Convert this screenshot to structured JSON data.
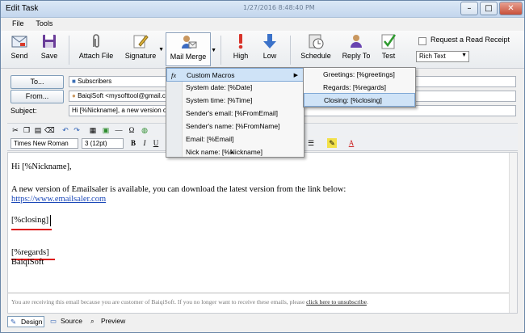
{
  "window": {
    "title": "Edit Task",
    "center_text": "1/27/2016 8:48:40 PM"
  },
  "menubar": [
    "File",
    "Tools"
  ],
  "toolbar": {
    "send": "Send",
    "save": "Save",
    "attach": "Attach File",
    "signature": "Signature",
    "mail_merge": "Mail Merge",
    "high": "High",
    "low": "Low",
    "schedule": "Schedule",
    "reply_to": "Reply To",
    "test": "Test",
    "read_receipt": "Request a Read Receipt",
    "format": "Rich Text"
  },
  "header": {
    "to_button": "To...",
    "to_value": "Subscribers",
    "from_button": "From...",
    "from_value": "BaiqiSoft <mysofttool@gmail.com>",
    "subject_label": "Subject:",
    "subject_value": "Hi [%Nickname], a new version of E"
  },
  "format_bar": {
    "font": "Times New Roman",
    "size": "3 (12pt)"
  },
  "mail_merge_menu": [
    "Custom Macros",
    "System date:  [%Date]",
    "System time:  [%Time]",
    "Sender's email:  [%FromEmail]",
    "Sender's name:  [%FromName]",
    "Email:  [%Email]",
    "Nick name:  [%Nickname]"
  ],
  "custom_macros_menu": [
    "Greetings:  [%greetings]",
    "Regards:  [%regards]",
    "Closing:  [%closing]"
  ],
  "body": {
    "line1": "Hi [%Nickname],",
    "line2": "A new version of Emailsaler is available, you can download the latest version from the link below:",
    "link": "https://www.emailsaler.com",
    "closing": "[%closing]",
    "regards": "[%regards]",
    "signature": "BaiqiSoft",
    "footer_pre": "You are receiving this email because you are customer of BaiqiSoft. If you no longer want to receive these emails, please ",
    "footer_link": "click here to unsubscribe",
    "footer_post": "."
  },
  "tabs": {
    "design": "Design",
    "source": "Source",
    "preview": "Preview"
  }
}
